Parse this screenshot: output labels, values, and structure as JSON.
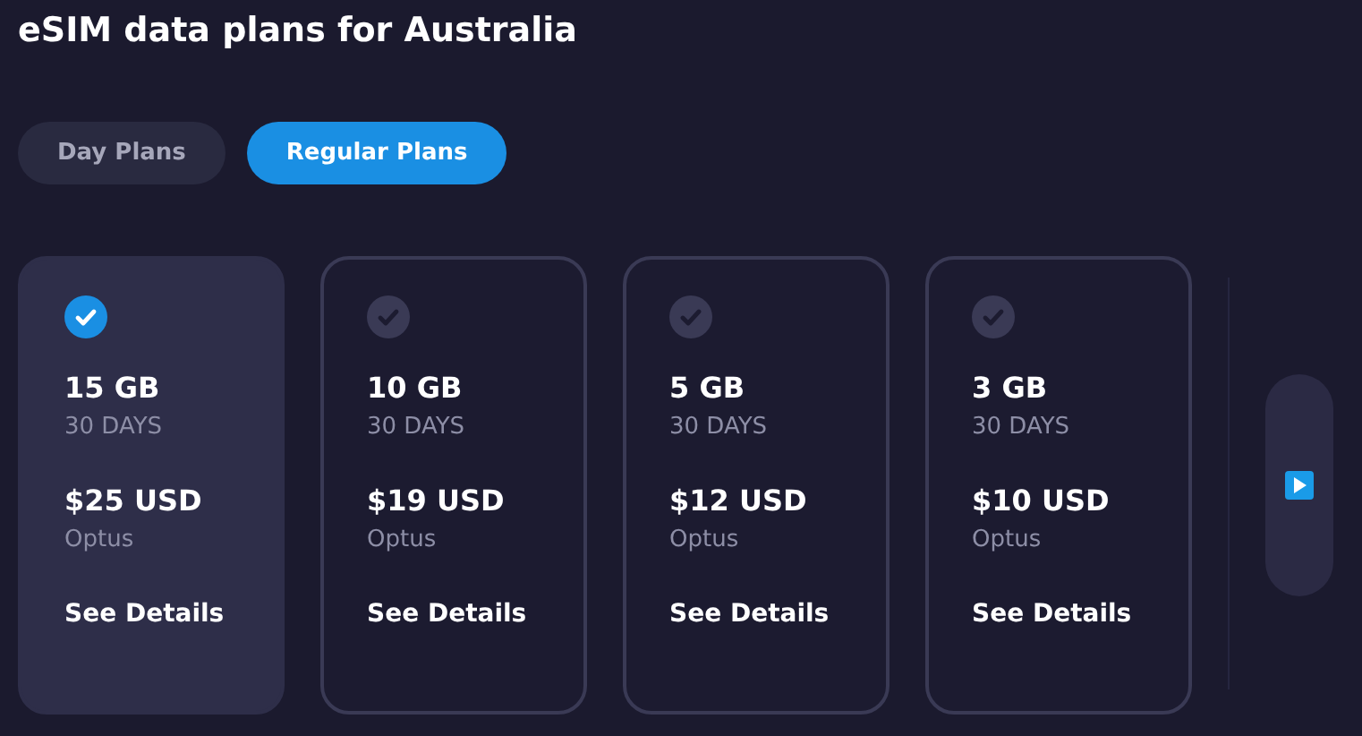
{
  "title": "eSIM data plans for Australia",
  "tabs": [
    {
      "label": "Day Plans",
      "selected": false
    },
    {
      "label": "Regular Plans",
      "selected": true
    }
  ],
  "plans": [
    {
      "data": "15 GB",
      "duration": "30 DAYS",
      "price": "$25 USD",
      "network": "Optus",
      "link": "See Details",
      "selected": true
    },
    {
      "data": "10 GB",
      "duration": "30 DAYS",
      "price": "$19 USD",
      "network": "Optus",
      "link": "See Details",
      "selected": false
    },
    {
      "data": "5 GB",
      "duration": "30 DAYS",
      "price": "$12 USD",
      "network": "Optus",
      "link": "See Details",
      "selected": false
    },
    {
      "data": "3 GB",
      "duration": "30 DAYS",
      "price": "$10 USD",
      "network": "Optus",
      "link": "See Details",
      "selected": false
    }
  ]
}
